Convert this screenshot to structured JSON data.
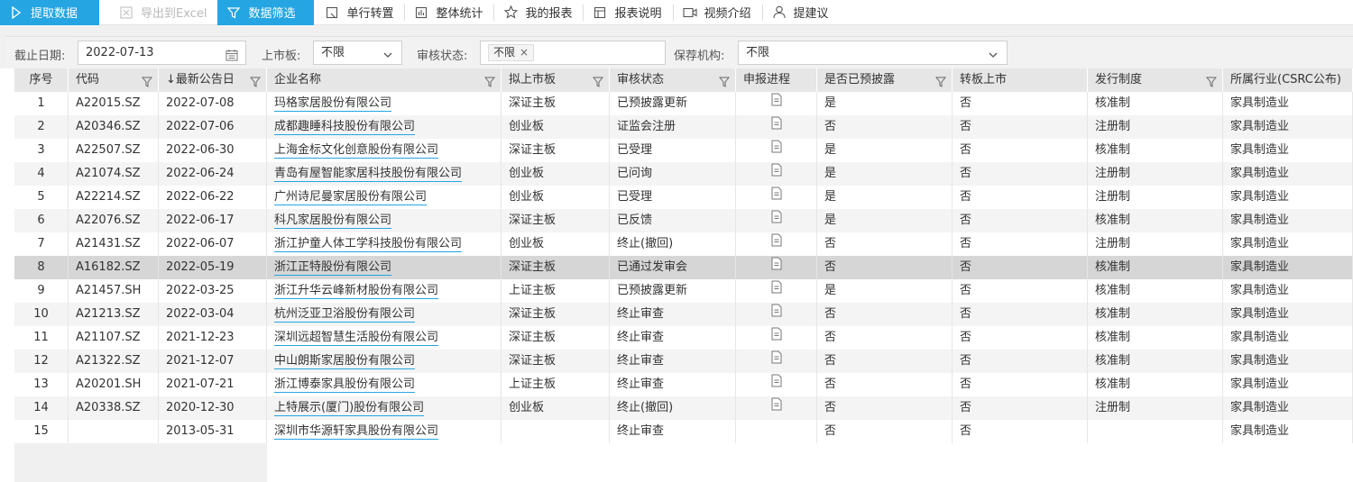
{
  "toolbar": {
    "buttons": [
      {
        "label": "提取数据",
        "icon": "play-icon"
      },
      {
        "label": "导出到Excel",
        "icon": "excel-icon"
      },
      {
        "label": "数据筛选",
        "icon": "filter-icon"
      },
      {
        "label": "单行转置",
        "icon": "transpose-icon"
      },
      {
        "label": "整体统计",
        "icon": "bar-chart-icon"
      },
      {
        "label": "我的报表",
        "icon": "star-icon"
      },
      {
        "label": "报表说明",
        "icon": "table-info-icon"
      },
      {
        "label": "视频介绍",
        "icon": "video-icon"
      },
      {
        "label": "提建议",
        "icon": "user-icon"
      }
    ]
  },
  "filters": {
    "date_label": "截止日期:",
    "date_value": "2022-07-13",
    "board_label": "上市板:",
    "board_value": "不限",
    "review_label": "审核状态:",
    "review_tag": "不限",
    "sponsor_label": "保荐机构:",
    "sponsor_value": "不限"
  },
  "table": {
    "headers": [
      "序号",
      "代码",
      "↓最新公告日",
      "企业名称",
      "拟上市板",
      "审核状态",
      "申报进程",
      "是否已预披露",
      "转板上市",
      "发行制度",
      "所属行业(CSRC公布)"
    ],
    "rows": [
      [
        "1",
        "A22015.SZ",
        "2022-07-08",
        "玛格家居股份有限公司",
        "深证主板",
        "已预披露更新",
        "doc",
        "是",
        "否",
        "核准制",
        "家具制造业"
      ],
      [
        "2",
        "A20346.SZ",
        "2022-07-06",
        "成都趣睡科技股份有限公司",
        "创业板",
        "证监会注册",
        "doc",
        "否",
        "否",
        "注册制",
        "家具制造业"
      ],
      [
        "3",
        "A22507.SZ",
        "2022-06-30",
        "上海金标文化创意股份有限公司",
        "深证主板",
        "已受理",
        "doc",
        "是",
        "否",
        "核准制",
        "家具制造业"
      ],
      [
        "4",
        "A21074.SZ",
        "2022-06-24",
        "青岛有屋智能家居科技股份有限公司",
        "创业板",
        "已问询",
        "doc",
        "是",
        "否",
        "注册制",
        "家具制造业"
      ],
      [
        "5",
        "A22214.SZ",
        "2022-06-22",
        "广州诗尼曼家居股份有限公司",
        "创业板",
        "已受理",
        "doc",
        "是",
        "否",
        "注册制",
        "家具制造业"
      ],
      [
        "6",
        "A22076.SZ",
        "2022-06-17",
        "科凡家居股份有限公司",
        "深证主板",
        "已反馈",
        "doc",
        "是",
        "否",
        "核准制",
        "家具制造业"
      ],
      [
        "7",
        "A21431.SZ",
        "2022-06-07",
        "浙江护童人体工学科技股份有限公司",
        "创业板",
        "终止(撤回)",
        "doc",
        "否",
        "否",
        "注册制",
        "家具制造业"
      ],
      [
        "8",
        "A16182.SZ",
        "2022-05-19",
        "浙江正特股份有限公司",
        "深证主板",
        "已通过发审会",
        "doc",
        "否",
        "否",
        "核准制",
        "家具制造业"
      ],
      [
        "9",
        "A21457.SH",
        "2022-03-25",
        "浙江升华云峰新材股份有限公司",
        "上证主板",
        "已预披露更新",
        "doc",
        "是",
        "否",
        "核准制",
        "家具制造业"
      ],
      [
        "10",
        "A21213.SZ",
        "2022-03-04",
        "杭州泛亚卫浴股份有限公司",
        "深证主板",
        "终止审查",
        "doc",
        "否",
        "否",
        "核准制",
        "家具制造业"
      ],
      [
        "11",
        "A21107.SZ",
        "2021-12-23",
        "深圳远超智慧生活股份有限公司",
        "深证主板",
        "终止审查",
        "doc",
        "否",
        "否",
        "核准制",
        "家具制造业"
      ],
      [
        "12",
        "A21322.SZ",
        "2021-12-07",
        "中山朗斯家居股份有限公司",
        "深证主板",
        "终止审查",
        "doc",
        "否",
        "否",
        "核准制",
        "家具制造业"
      ],
      [
        "13",
        "A20201.SH",
        "2021-07-21",
        "浙江博泰家具股份有限公司",
        "上证主板",
        "终止审查",
        "doc",
        "否",
        "否",
        "核准制",
        "家具制造业"
      ],
      [
        "14",
        "A20338.SZ",
        "2020-12-30",
        "上特展示(厦门)股份有限公司",
        "创业板",
        "终止(撤回)",
        "doc",
        "否",
        "否",
        "注册制",
        "家具制造业"
      ],
      [
        "15",
        "",
        "2013-05-31",
        "深圳市华源轩家具股份有限公司",
        "",
        "终止审查",
        "",
        "否",
        "否",
        "",
        "家具制造业"
      ]
    ],
    "selected_row": 8
  },
  "colors": {
    "accent": "#25a5e2",
    "header_bg": "#e6e6e6",
    "row_alt": "#f4f4f4",
    "row_selected": "#d6d6d6"
  }
}
